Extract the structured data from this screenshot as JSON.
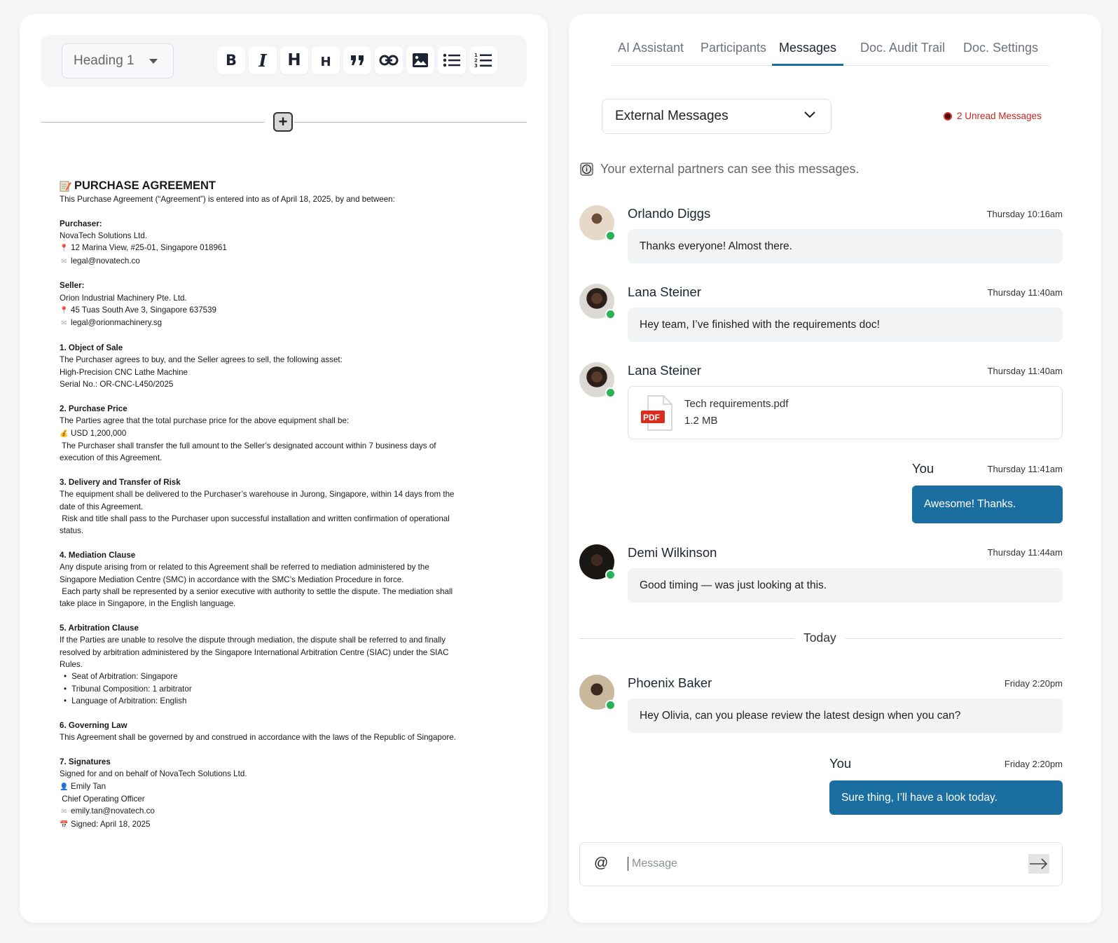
{
  "editor": {
    "toolbar": {
      "block_type": "Heading 1",
      "bold": "B",
      "italic": "I",
      "heading_large": "H",
      "heading_small": "H"
    },
    "add_block": "+",
    "document": {
      "title_icon": "memo-icon",
      "title": "PURCHASE AGREEMENT",
      "intro": "This Purchase Agreement (“Agreement”) is entered into as of April 18, 2025, by and between:",
      "purchaser_label": "Purchaser:",
      "purchaser_name": "NovaTech Solutions Ltd.",
      "purchaser_address": "12 Marina View, #25-01, Singapore 018961",
      "purchaser_email": "legal@novatech.co",
      "seller_label": "Seller:",
      "seller_name": "Orion Industrial Machinery Pte. Ltd.",
      "seller_address": "45 Tuas South Ave 3, Singapore 637539",
      "seller_email": "legal@orionmachinery.sg",
      "s1_title": "1. Object of Sale",
      "s1_l1": "The Purchaser agrees to buy, and the Seller agrees to sell, the following asset:",
      "s1_l2": "High-Precision CNC Lathe Machine",
      "s1_l3": "Serial No.: OR-CNC-L450/2025",
      "s2_title": "2. Purchase Price",
      "s2_l1": "The Parties agree that the total purchase price for the above equipment shall be:",
      "s2_l2": "USD 1,200,000",
      "s2_l3": " The Purchaser shall transfer the full amount to the Seller’s designated account within 7 business days of",
      "s2_l4": "execution of this Agreement.",
      "s3_title": "3. Delivery and Transfer of Risk",
      "s3_l1": "The equipment shall be delivered to the Purchaser’s warehouse in Jurong, Singapore, within 14 days from the",
      "s3_l2": "date of this Agreement.",
      "s3_l3": " Risk and title shall pass to the Purchaser upon successful installation and written confirmation of operational",
      "s3_l4": "status.",
      "s4_title": "4. Mediation Clause",
      "s4_l1": "Any dispute arising from or related to this Agreement shall be referred to mediation administered by the",
      "s4_l2": "Singapore Mediation Centre (SMC) in accordance with the SMC’s Mediation Procedure in force.",
      "s4_l3": " Each party shall be represented by a senior executive with authority to settle the dispute. The mediation shall",
      "s4_l4": "take place in Singapore, in the English language.",
      "s5_title": "5. Arbitration Clause",
      "s5_l1": "If the Parties are unable to resolve the dispute through mediation, the dispute shall be referred to and finally",
      "s5_l2": "resolved by arbitration administered by the Singapore International Arbitration Centre (SIAC) under the SIAC",
      "s5_l3": "Rules.",
      "s5_b1": "Seat of Arbitration: Singapore",
      "s5_b2": "Tribunal Composition: 1 arbitrator",
      "s5_b3": "Language of Arbitration: English",
      "s6_title": "6. Governing Law",
      "s6_l1": "This Agreement shall be governed by and construed in accordance with the laws of the Republic of Singapore.",
      "s7_title": "7. Signatures",
      "s7_l1": "Signed for and on behalf of NovaTech Solutions Ltd.",
      "s7_l2": "Emily Tan",
      "s7_l3": " Chief Operating Officer",
      "s7_l4": "emily.tan@novatech.co",
      "s7_l5": "Signed: April 18, 2025"
    }
  },
  "chat": {
    "tabs": [
      {
        "label": "AI Assistant"
      },
      {
        "label": "Participants"
      },
      {
        "label": "Messages",
        "active": true
      },
      {
        "label": "Doc. Audit Trail"
      },
      {
        "label": "Doc. Settings"
      }
    ],
    "channel": "External Messages",
    "unread": "2 Unread Messages",
    "info": "Your external partners can see this messages.",
    "messages": [
      {
        "name": "Orlando Diggs",
        "time": "Thursday 10:16am",
        "text": "Thanks everyone! Almost there."
      },
      {
        "name": "Lana Steiner",
        "time": "Thursday 11:40am",
        "text": "Hey team, I’ve finished with the requirements doc!"
      },
      {
        "name": "Lana Steiner",
        "time": "Thursday 11:40am",
        "file_name": "Tech requirements.pdf",
        "file_size": "1.2 MB",
        "file_badge": "PDF"
      },
      {
        "name": "You",
        "time": "Thursday 11:41am",
        "text": "Awesome! Thanks."
      },
      {
        "name": "Demi Wilkinson",
        "time": "Thursday 11:44am",
        "text": "Good timing — was just looking at this."
      },
      {
        "name": "Phoenix Baker",
        "time": "Friday 2:20pm",
        "text": "Hey Olivia, can you please review the latest design when you can?"
      },
      {
        "name": "You",
        "time": "Friday 2:20pm",
        "text": "Sure thing, I’ll have a look today."
      }
    ],
    "separator": "Today",
    "composer": {
      "at": "@",
      "placeholder": "Message"
    },
    "colors": {
      "accent": "#1a6fa0",
      "unread": "#c0271d",
      "online": "#28b35a"
    }
  }
}
